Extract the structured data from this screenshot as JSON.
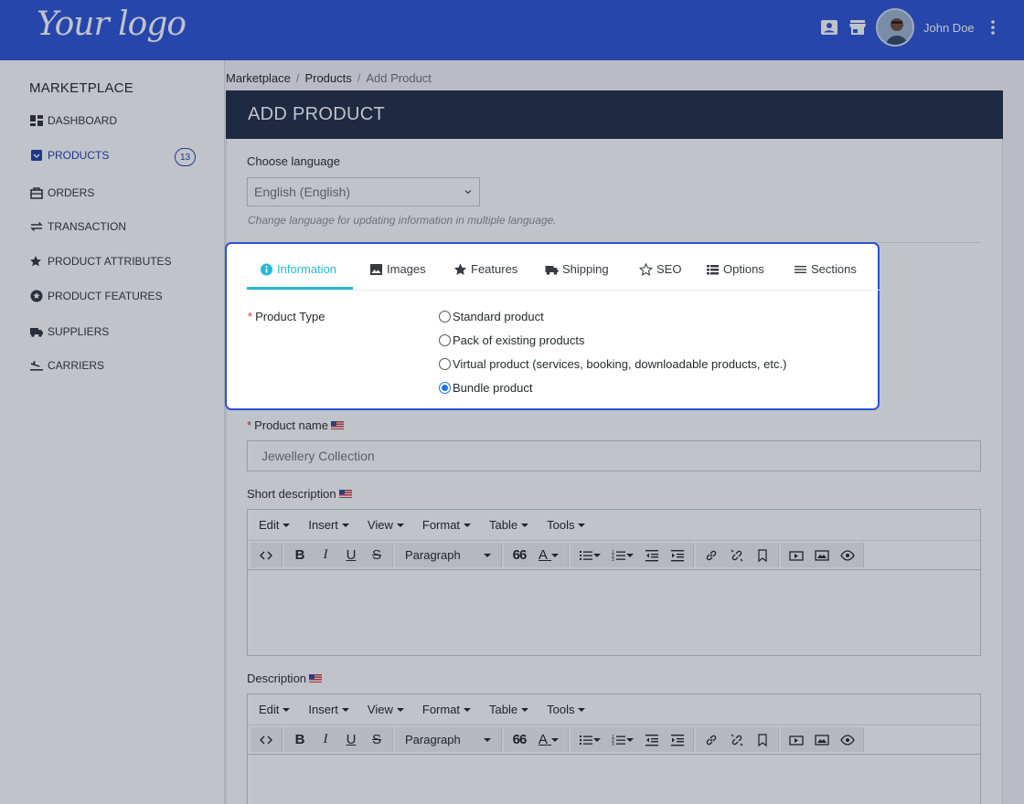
{
  "header": {
    "logo": "Your logo",
    "user_name": "John Doe",
    "icons": [
      "contact-card-icon",
      "store-icon",
      "avatar",
      "more-vertical-icon"
    ]
  },
  "sidebar": {
    "title": "MARKETPLACE",
    "items": [
      {
        "label": "DASHBOARD",
        "icon": "dashboard-icon"
      },
      {
        "label": "PRODUCTS",
        "icon": "box-icon",
        "badge": "13",
        "active": true
      },
      {
        "label": "ORDERS",
        "icon": "orders-icon"
      },
      {
        "label": "TRANSACTION",
        "icon": "transfer-icon"
      },
      {
        "label": "PRODUCT ATTRIBUTES",
        "icon": "star-edit-icon"
      },
      {
        "label": "PRODUCT FEATURES",
        "icon": "star-circle-icon"
      },
      {
        "label": "SUPPLIERS",
        "icon": "truck-icon"
      },
      {
        "label": "CARRIERS",
        "icon": "flight-land-icon"
      }
    ]
  },
  "breadcrumb": {
    "items": [
      "Marketplace",
      "Products",
      "Add Product"
    ],
    "sep": "/"
  },
  "page": {
    "title": "ADD PRODUCT"
  },
  "language": {
    "label": "Choose language",
    "value": "English (English)",
    "help": "Change language for updating information in multiple language."
  },
  "tabs": {
    "items": [
      {
        "label": "Information",
        "icon": "info-icon",
        "active": true
      },
      {
        "label": "Images",
        "icon": "image-icon"
      },
      {
        "label": "Features",
        "icon": "star-icon"
      },
      {
        "label": "Shipping",
        "icon": "truck-icon"
      },
      {
        "label": "SEO",
        "icon": "star-outline-icon"
      },
      {
        "label": "Options",
        "icon": "list-icon"
      },
      {
        "label": "Sections",
        "icon": "menu-icon"
      }
    ]
  },
  "product_type": {
    "label": "Product Type",
    "required_mark": "*",
    "options": [
      {
        "label": "Standard product",
        "checked": false
      },
      {
        "label": "Pack of existing products",
        "checked": false
      },
      {
        "label": "Virtual product (services, booking, downloadable products, etc.)",
        "checked": false
      },
      {
        "label": "Bundle product",
        "checked": true
      }
    ]
  },
  "product_name": {
    "label": "Product name",
    "required_mark": "*",
    "placeholder": "Jewellery Collection"
  },
  "short_description": {
    "label": "Short description"
  },
  "description": {
    "label": "Description"
  },
  "editor": {
    "menus": [
      "Edit",
      "Insert",
      "View",
      "Format",
      "Table",
      "Tools"
    ],
    "format_select": "Paragraph",
    "bold": "B",
    "italic": "I",
    "underline": "U",
    "strike": "S",
    "quote": "66",
    "text_color": "A"
  },
  "colors": {
    "header": "#2a52d6",
    "panel_head": "#1f2a44",
    "accent": "#25b9d7",
    "highlight": "#2a52d6"
  }
}
